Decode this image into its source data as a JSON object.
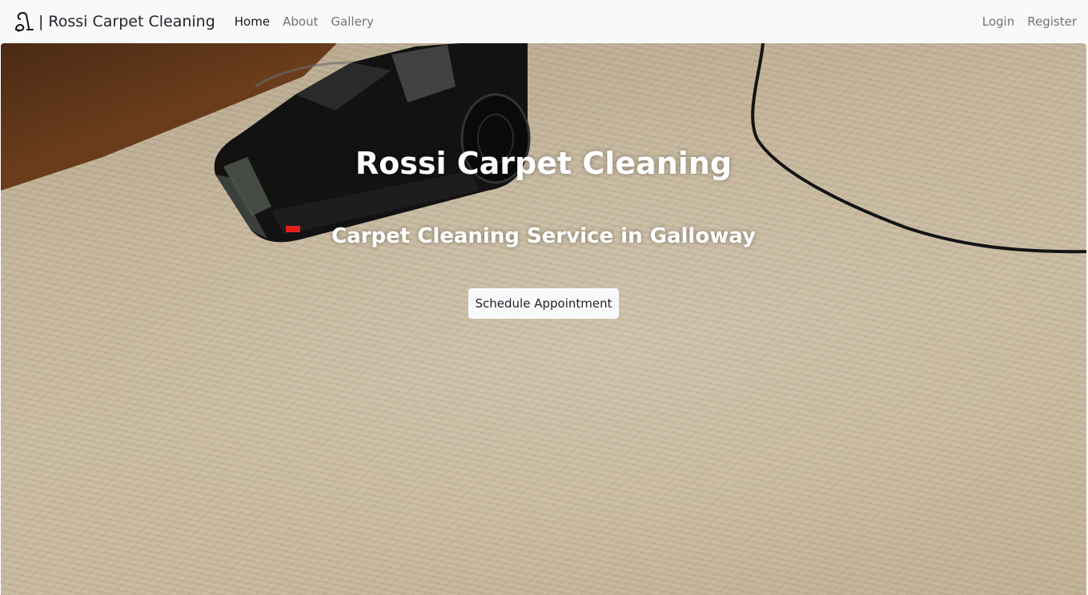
{
  "navbar": {
    "brand_separator": "|",
    "brand_name": "Rossi Carpet Cleaning",
    "links": [
      {
        "label": "Home",
        "active": true
      },
      {
        "label": "About",
        "active": false
      },
      {
        "label": "Gallery",
        "active": false
      }
    ],
    "right_links": [
      {
        "label": "Login"
      },
      {
        "label": "Register"
      }
    ],
    "logo_icon": "vacuum-cleaner-icon"
  },
  "hero": {
    "title": "Rossi Carpet Cleaning",
    "subtitle": "Carpet Cleaning Service in Galloway",
    "cta_label": "Schedule Appointment",
    "background_image": "carpet-cleaner-on-beige-carpet"
  },
  "colors": {
    "navbar_bg": "#f8f9fa",
    "hero_text": "#ffffff",
    "button_bg": "#f8f9fa",
    "text_dark": "#212529"
  }
}
